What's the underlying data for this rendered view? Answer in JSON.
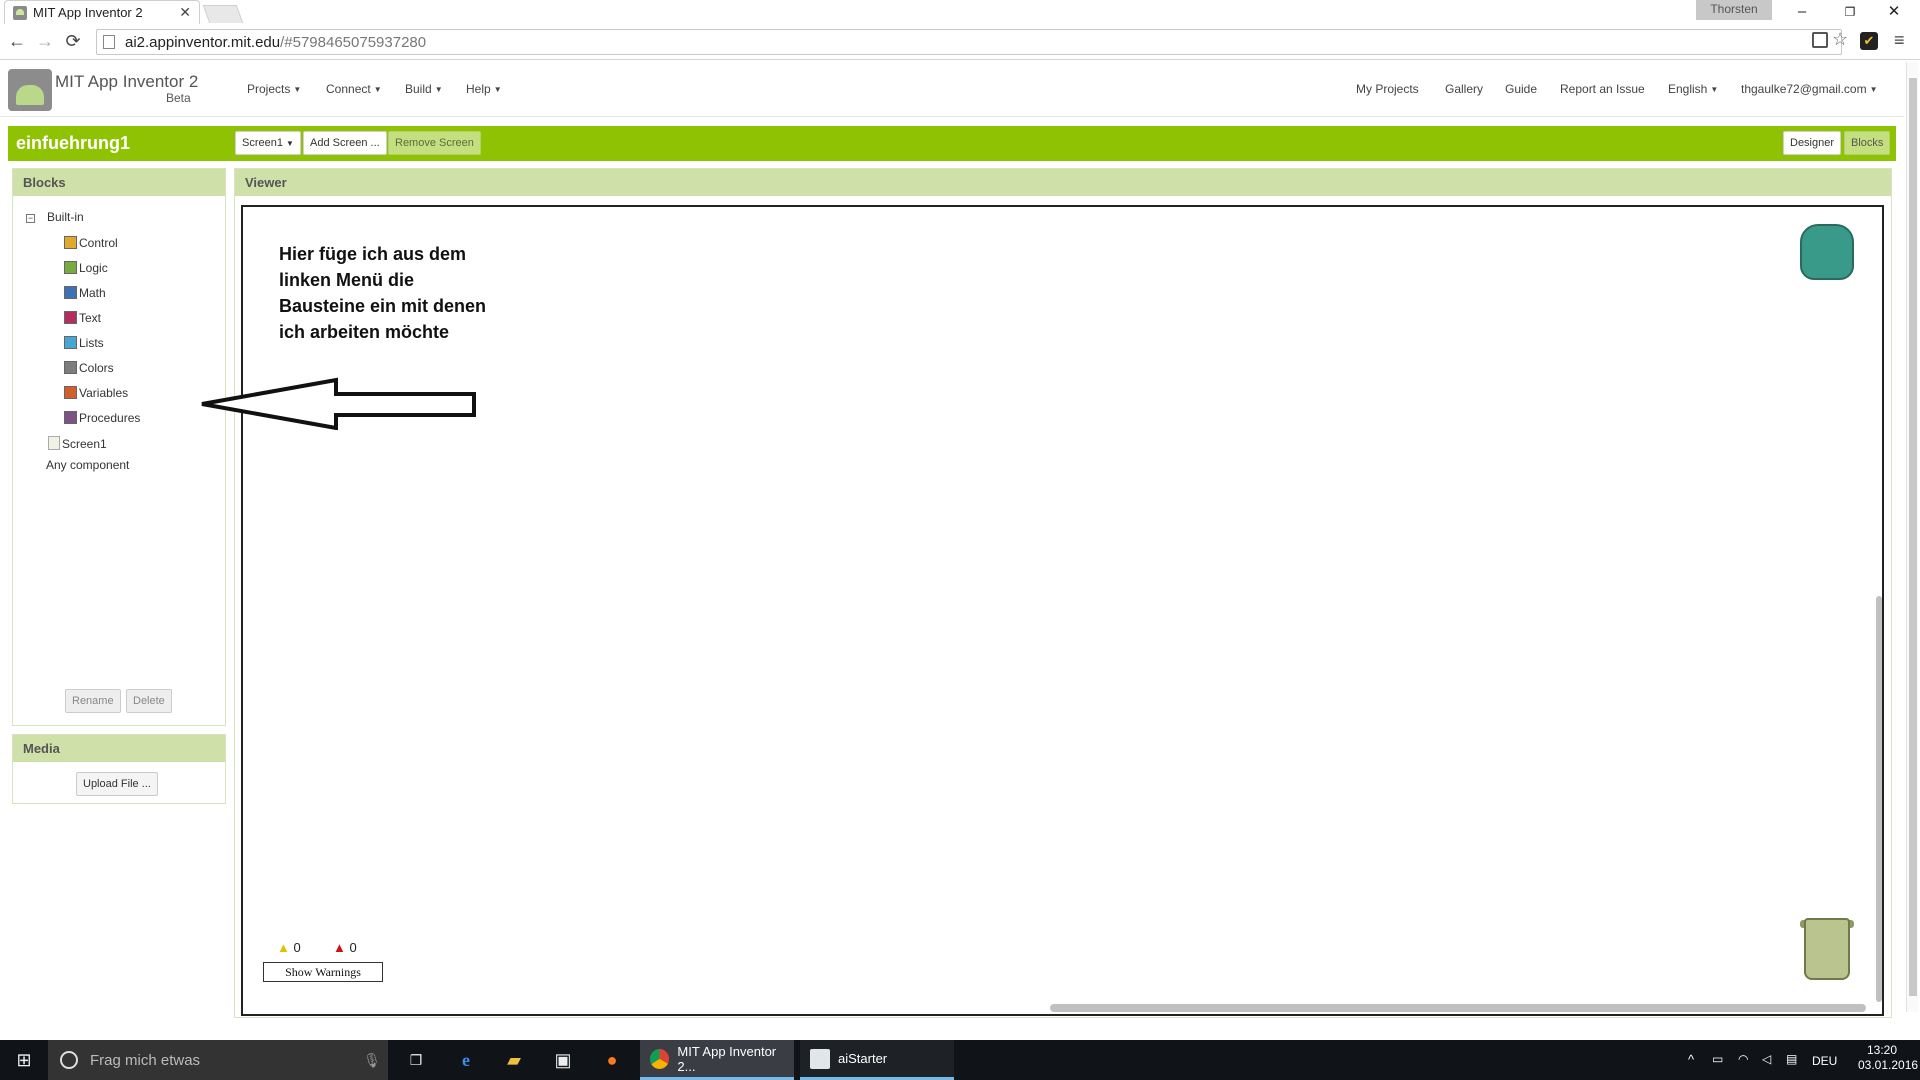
{
  "browser": {
    "tab_title": "MIT App Inventor 2",
    "tab_close": "✕",
    "profile_name": "Thorsten",
    "url_host": "ai2.appinventor.mit.edu",
    "url_path": "/#5798465075937280",
    "nav": {
      "back": "←",
      "forward": "→",
      "reload": "⟳"
    },
    "window_buttons": {
      "minimize": "–",
      "restore": "❐",
      "close": "✕"
    }
  },
  "app": {
    "title": "MIT App Inventor 2",
    "subtitle": "Beta",
    "left_menus": [
      "Projects",
      "Connect",
      "Build",
      "Help"
    ],
    "right_links": {
      "my_projects": "My Projects",
      "gallery": "Gallery",
      "guide": "Guide",
      "report": "Report an Issue",
      "language": "English",
      "account": "thgaulke72@gmail.com"
    },
    "project_name": "einfuehrung1",
    "screen_select": "Screen1",
    "add_screen": "Add Screen ...",
    "remove_screen": "Remove Screen",
    "designer_btn": "Designer",
    "blocks_btn": "Blocks"
  },
  "blocks_panel": {
    "title": "Blocks",
    "builtin_label": "Built-in",
    "builtin": [
      {
        "label": "Control",
        "color": "#e1a92c"
      },
      {
        "label": "Logic",
        "color": "#77ab41"
      },
      {
        "label": "Math",
        "color": "#3f71b5"
      },
      {
        "label": "Text",
        "color": "#b32d5e"
      },
      {
        "label": "Lists",
        "color": "#49a6d4"
      },
      {
        "label": "Colors",
        "color": "#7d7d7d"
      },
      {
        "label": "Variables",
        "color": "#d05f2d"
      },
      {
        "label": "Procedures",
        "color": "#7c5385"
      }
    ],
    "screen_item": "Screen1",
    "any_component": "Any component",
    "rename": "Rename",
    "delete": "Delete"
  },
  "media_panel": {
    "title": "Media",
    "upload": "Upload File ..."
  },
  "viewer": {
    "title": "Viewer",
    "note_lines": [
      "Hier füge ich aus dem",
      "linken Menü die",
      "Bausteine ein mit denen",
      "ich arbeiten möchte"
    ],
    "warnings_count": "0",
    "errors_count": "0",
    "show_warnings": "Show Warnings"
  },
  "taskbar": {
    "search_placeholder": "Frag mich etwas",
    "apps": [
      {
        "label": "MIT App Inventor 2..."
      },
      {
        "label": "aiStarter"
      }
    ],
    "lang": "DEU",
    "time": "13:20",
    "date": "03.01.2016"
  }
}
